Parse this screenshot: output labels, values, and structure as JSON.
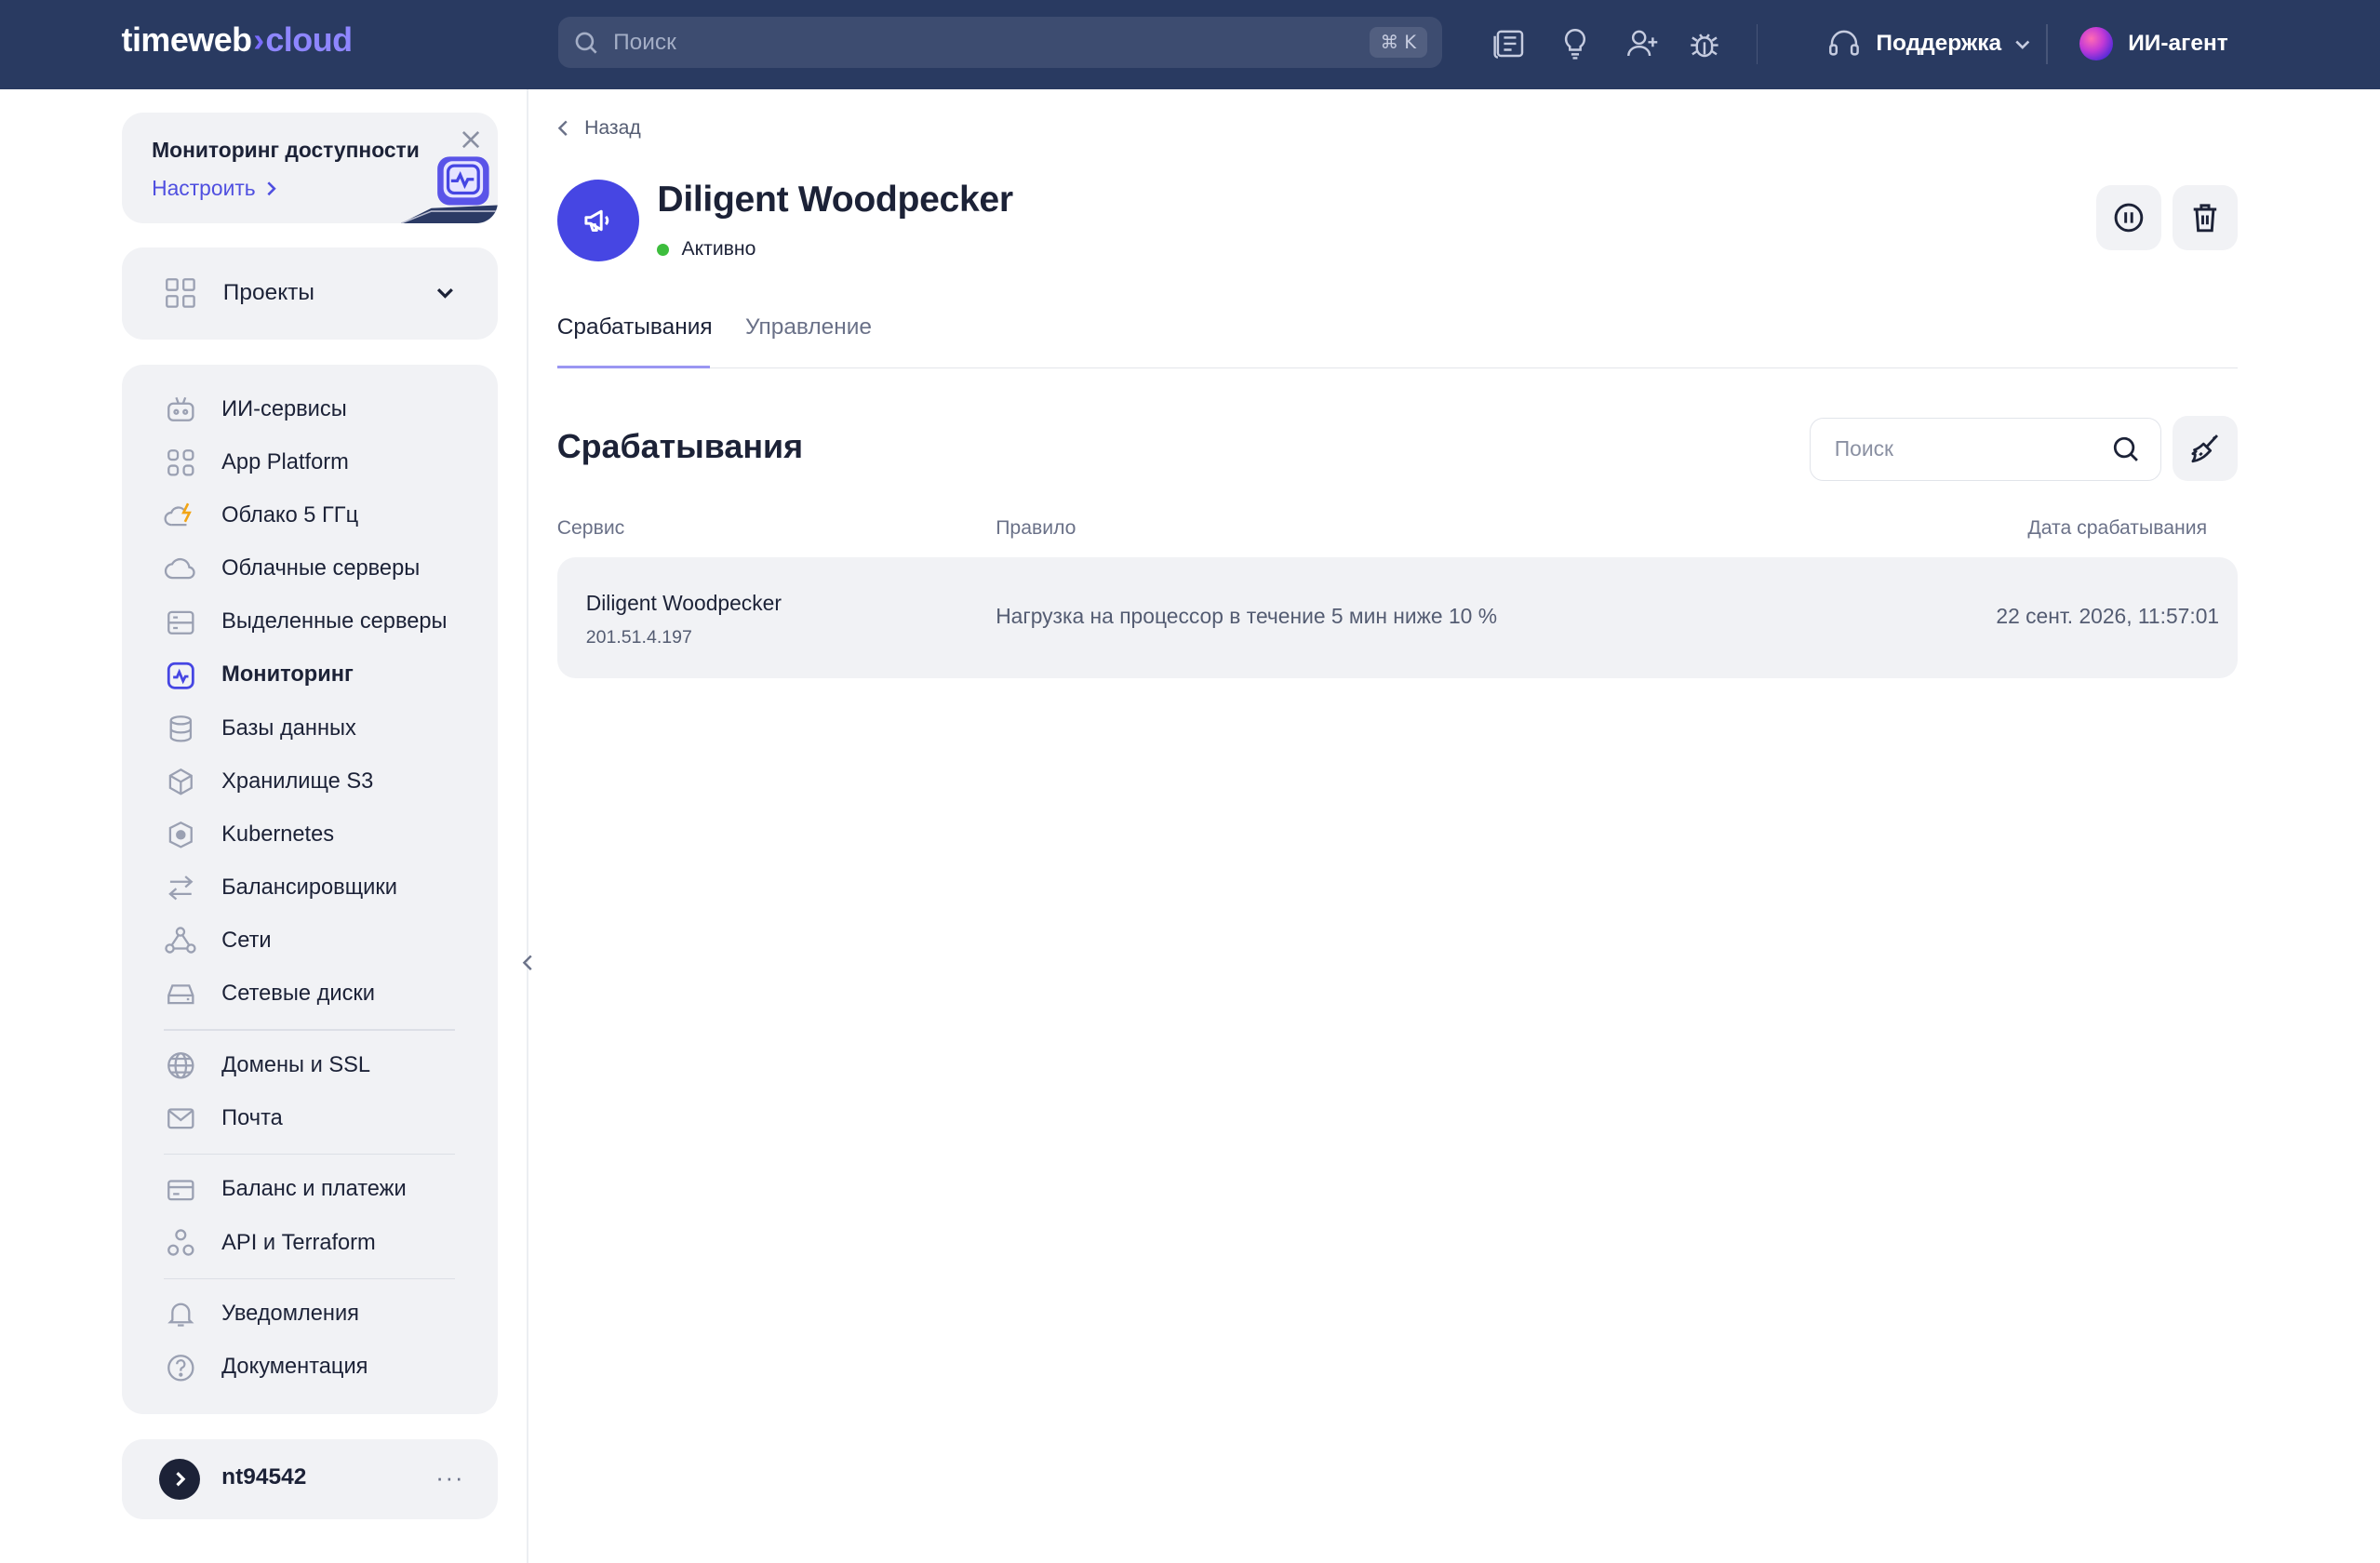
{
  "header": {
    "logo_main": "timeweb",
    "logo_accent": "cloud",
    "search_placeholder": "Поиск",
    "search_shortcut": "⌘ K",
    "support_label": "Поддержка",
    "agent_label": "ИИ-агент"
  },
  "sidebar": {
    "promo": {
      "title": "Мониторинг доступности",
      "link": "Настроить"
    },
    "projects_label": "Проекты",
    "items": [
      {
        "label": "ИИ-сервисы",
        "icon": "robot-icon"
      },
      {
        "label": "App Platform",
        "icon": "grid-icon"
      },
      {
        "label": "Облако 5 ГГц",
        "icon": "cloud-bolt-icon"
      },
      {
        "label": "Облачные серверы",
        "icon": "cloud-icon"
      },
      {
        "label": "Выделенные серверы",
        "icon": "server-icon"
      },
      {
        "label": "Мониторинг",
        "icon": "monitoring-icon",
        "active": true
      },
      {
        "label": "Базы данных",
        "icon": "database-icon"
      },
      {
        "label": "Хранилище S3",
        "icon": "cube-icon"
      },
      {
        "label": "Kubernetes",
        "icon": "kubernetes-icon"
      },
      {
        "label": "Балансировщики",
        "icon": "arrows-icon"
      },
      {
        "label": "Сети",
        "icon": "network-icon"
      },
      {
        "label": "Сетевые диски",
        "icon": "disk-icon"
      },
      {
        "label": "Домены и SSL",
        "icon": "globe-icon"
      },
      {
        "label": "Почта",
        "icon": "mail-icon"
      },
      {
        "label": "Баланс и платежи",
        "icon": "card-icon"
      },
      {
        "label": "API и Terraform",
        "icon": "api-icon"
      },
      {
        "label": "Уведомления",
        "icon": "bell-icon"
      },
      {
        "label": "Документация",
        "icon": "help-icon"
      }
    ],
    "user": {
      "name": "nt94542",
      "more": "···"
    }
  },
  "main": {
    "back_label": "Назад",
    "title": "Diligent Woodpecker",
    "status": "Активно",
    "tabs": [
      {
        "label": "Срабатывания",
        "active": true
      },
      {
        "label": "Управление",
        "active": false
      }
    ],
    "section_title": "Срабатывания",
    "search_placeholder": "Поиск",
    "table": {
      "headers": [
        "Сервис",
        "Правило",
        "Дата срабатывания"
      ],
      "rows": [
        {
          "service": "Diligent Woodpecker",
          "ip": "201.51.4.197",
          "rule": "Нагрузка на процессор в течение 5 мин ниже 10 %",
          "date": "22 сент. 2026, 11:57:01"
        }
      ]
    }
  },
  "colors": {
    "topbar": "#293a61",
    "accent": "#4646e3",
    "status_ok": "#3dbd3d",
    "card_bg": "#f1f2f5"
  }
}
